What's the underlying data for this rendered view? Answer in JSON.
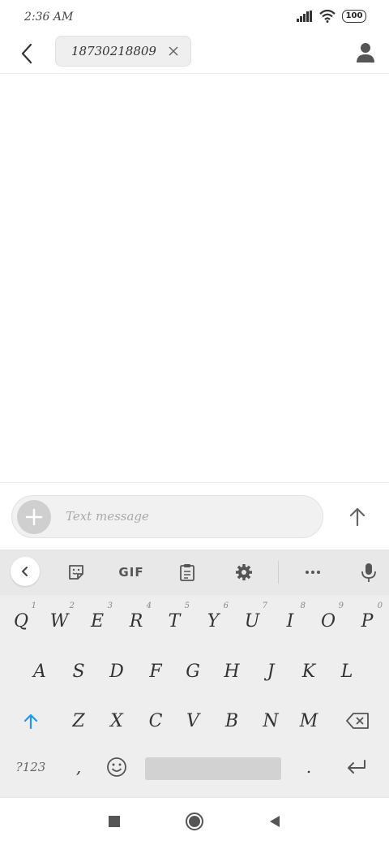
{
  "status_bar": {
    "time": "2:36 AM",
    "battery": "100"
  },
  "app_bar": {
    "recipient": "18730218809"
  },
  "compose": {
    "placeholder": "Text message"
  },
  "keyboard": {
    "toolbar": {
      "gif_label": "GIF"
    },
    "row1": [
      {
        "key": "Q",
        "hint": "1"
      },
      {
        "key": "W",
        "hint": "2"
      },
      {
        "key": "E",
        "hint": "3"
      },
      {
        "key": "R",
        "hint": "4"
      },
      {
        "key": "T",
        "hint": "5"
      },
      {
        "key": "Y",
        "hint": "6"
      },
      {
        "key": "U",
        "hint": "7"
      },
      {
        "key": "I",
        "hint": "8"
      },
      {
        "key": "O",
        "hint": "9"
      },
      {
        "key": "P",
        "hint": "0"
      }
    ],
    "row2": [
      "A",
      "S",
      "D",
      "F",
      "G",
      "H",
      "J",
      "K",
      "L"
    ],
    "row3": [
      "Z",
      "X",
      "C",
      "V",
      "B",
      "N",
      "M"
    ],
    "symbols_label": "?123",
    "comma_label": ",",
    "period_label": "."
  },
  "colors": {
    "accent": "#2196f3",
    "icon_gray": "#555555"
  }
}
